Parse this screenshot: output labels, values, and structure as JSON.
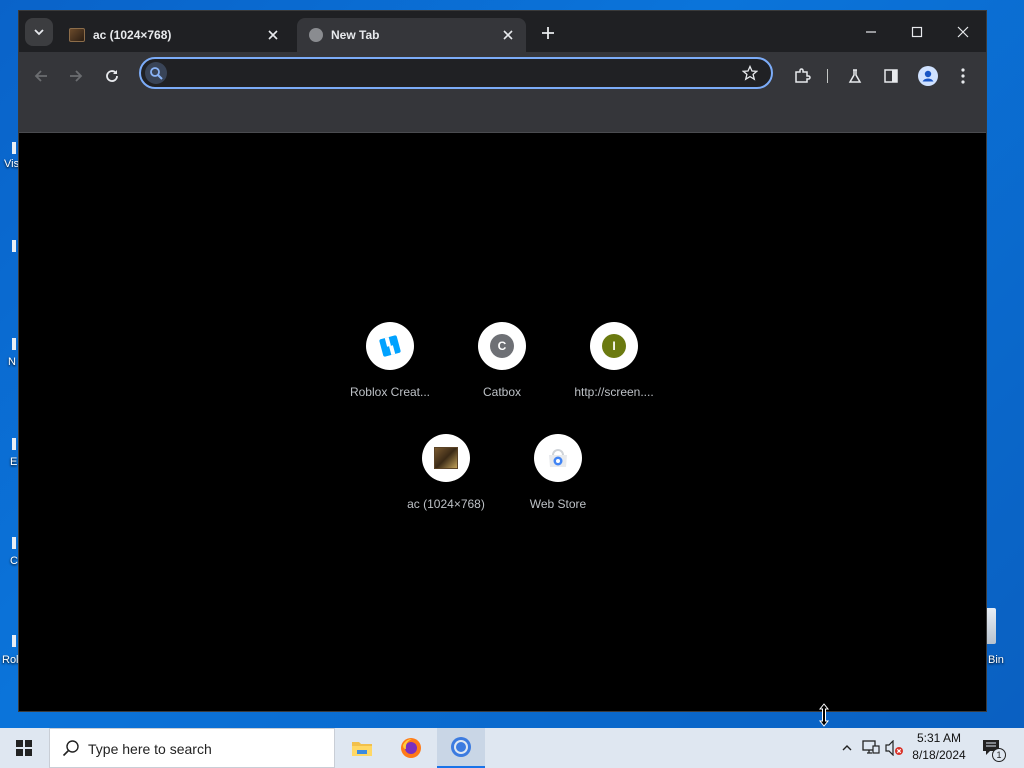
{
  "desktop": {
    "labels": [
      "Vis",
      "N",
      "E",
      "C",
      "Rol",
      "Bin"
    ]
  },
  "browser": {
    "tabs": [
      {
        "title": "ac (1024×768)",
        "active": false
      },
      {
        "title": "New Tab",
        "active": true
      }
    ],
    "omnibox": {
      "value": "",
      "placeholder": ""
    },
    "shortcuts": [
      {
        "label": "Roblox Creat...",
        "icon": "roblox-studio-icon"
      },
      {
        "label": "Catbox",
        "letter": "C",
        "icon": "catbox-letter-icon"
      },
      {
        "label": "http://screen....",
        "letter": "I",
        "icon": "screen-letter-icon"
      },
      {
        "label": "ac (1024×768)",
        "icon": "ac-thumbnail-icon"
      },
      {
        "label": "Web Store",
        "icon": "web-store-icon"
      }
    ]
  },
  "taskbar": {
    "search_placeholder": "Type here to search",
    "time": "5:31 AM",
    "date": "8/18/2024",
    "notification_count": "1"
  },
  "colors": {
    "accent": "#7cacf8",
    "tab_active": "#35363a",
    "tabstrip": "#1f2023",
    "page_bg": "#000000",
    "desktop": "#0b74da"
  }
}
